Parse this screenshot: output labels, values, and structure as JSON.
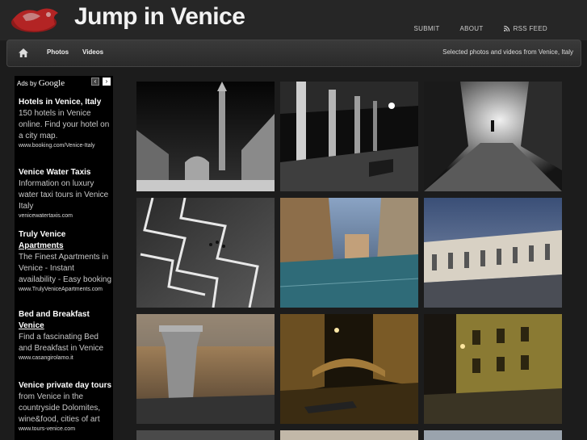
{
  "site": {
    "title": "Jump in Venice"
  },
  "top_links": [
    "SUBMIT",
    "ABOUT",
    "RSS FEED"
  ],
  "nav": {
    "items": [
      "Photos",
      "Videos"
    ],
    "tagline": "Selected photos and videos from Venice, Italy"
  },
  "ads": {
    "header": "Ads by",
    "brand": "Google",
    "items": [
      {
        "title": "Hotels in Venice, Italy",
        "desc": "150 hotels in Venice online. Find your hotel on a city map.",
        "url": "www.booking.com/Venice-Italy"
      },
      {
        "title": "Venice Water Taxis",
        "desc": "Information on luxury water taxi tours in Venice Italy",
        "url": "venicewatertaxis.com"
      },
      {
        "title_line1": "Truly Venice",
        "title_line2": "Apartments",
        "desc": "The Finest Apartments in Venice - Instant availability - Easy booking",
        "url": "www.TrulyVeniceApartments.com"
      },
      {
        "title_line1": "Bed and Breakfast",
        "title_line2": "Venice",
        "desc": "Find a fascinating Bed and Breakfast in Venice",
        "url": "www.casangirolamo.it"
      },
      {
        "title": "Venice private day tours",
        "desc": "from Venice in the countryside Dolomites, wine&food, cities of art",
        "url": "www.tours-venice.com"
      }
    ]
  },
  "photos": [
    "st-marks-square-night-photo",
    "arcade-columns-night-photo",
    "foggy-street-silhouette-photo",
    "square-pavement-pattern-photo",
    "flooded-square-photo",
    "procuratie-dusk-photo",
    "well-head-photo",
    "canal-bridge-night-photo",
    "yellow-facade-night-photo"
  ],
  "colors": {
    "background": "#1c1c1c",
    "ad_background": "#000000",
    "logo": "#9b1c1c"
  }
}
